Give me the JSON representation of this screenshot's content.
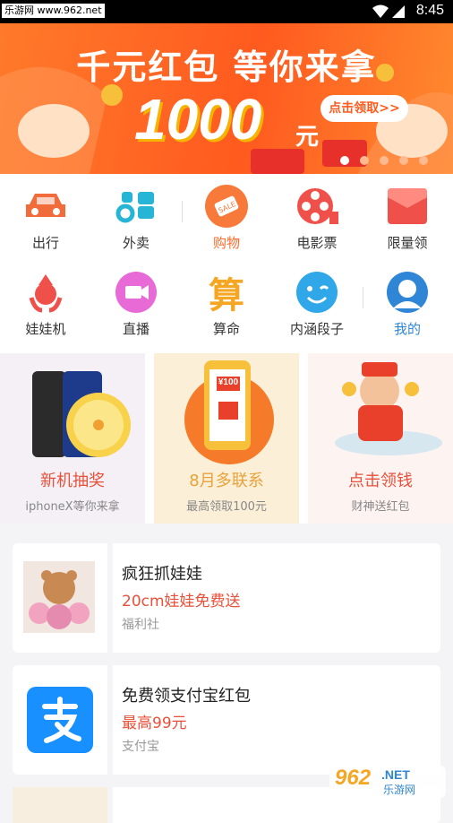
{
  "status_bar": {
    "watermark": "乐游网 www.962.net",
    "time": "8:45"
  },
  "banner": {
    "title": "千元红包 等你来拿",
    "amount": "1000",
    "unit": "元",
    "cta": "点击领取>>"
  },
  "grid": {
    "row1": [
      {
        "label": "出行",
        "icon": "car-icon"
      },
      {
        "label": "外卖",
        "icon": "delivery-icon"
      },
      {
        "label": "购物",
        "icon": "shopping-tag-icon"
      },
      {
        "label": "电影票",
        "icon": "film-reel-icon"
      },
      {
        "label": "限量领",
        "icon": "red-envelope-icon"
      }
    ],
    "row2": [
      {
        "label": "娃娃机",
        "icon": "claw-machine-icon"
      },
      {
        "label": "直播",
        "icon": "video-camera-icon"
      },
      {
        "label": "算命",
        "icon": "fortune-character-icon",
        "glyph": "算"
      },
      {
        "label": "内涵段子",
        "icon": "smiley-face-icon"
      },
      {
        "label": "我的",
        "icon": "user-avatar-icon"
      }
    ]
  },
  "promos": [
    {
      "title": "新机抽奖",
      "subtitle": "iphoneX等你来拿",
      "color": "#e8503a"
    },
    {
      "title": "8月多联系",
      "subtitle": "最高领取100元",
      "color": "#e8a23a",
      "badge": "¥100"
    },
    {
      "title": "点击领钱",
      "subtitle": "财神送红包",
      "color": "#e8503a"
    }
  ],
  "cards": [
    {
      "title": "疯狂抓娃娃",
      "highlight": "20cm娃娃免费送",
      "source": "福利社"
    },
    {
      "title": "免费领支付宝红包",
      "highlight": "最高99元",
      "source": "支付宝"
    }
  ],
  "corner_watermark": {
    "brand": "962",
    "tld": ".NET",
    "name": "乐游网"
  }
}
